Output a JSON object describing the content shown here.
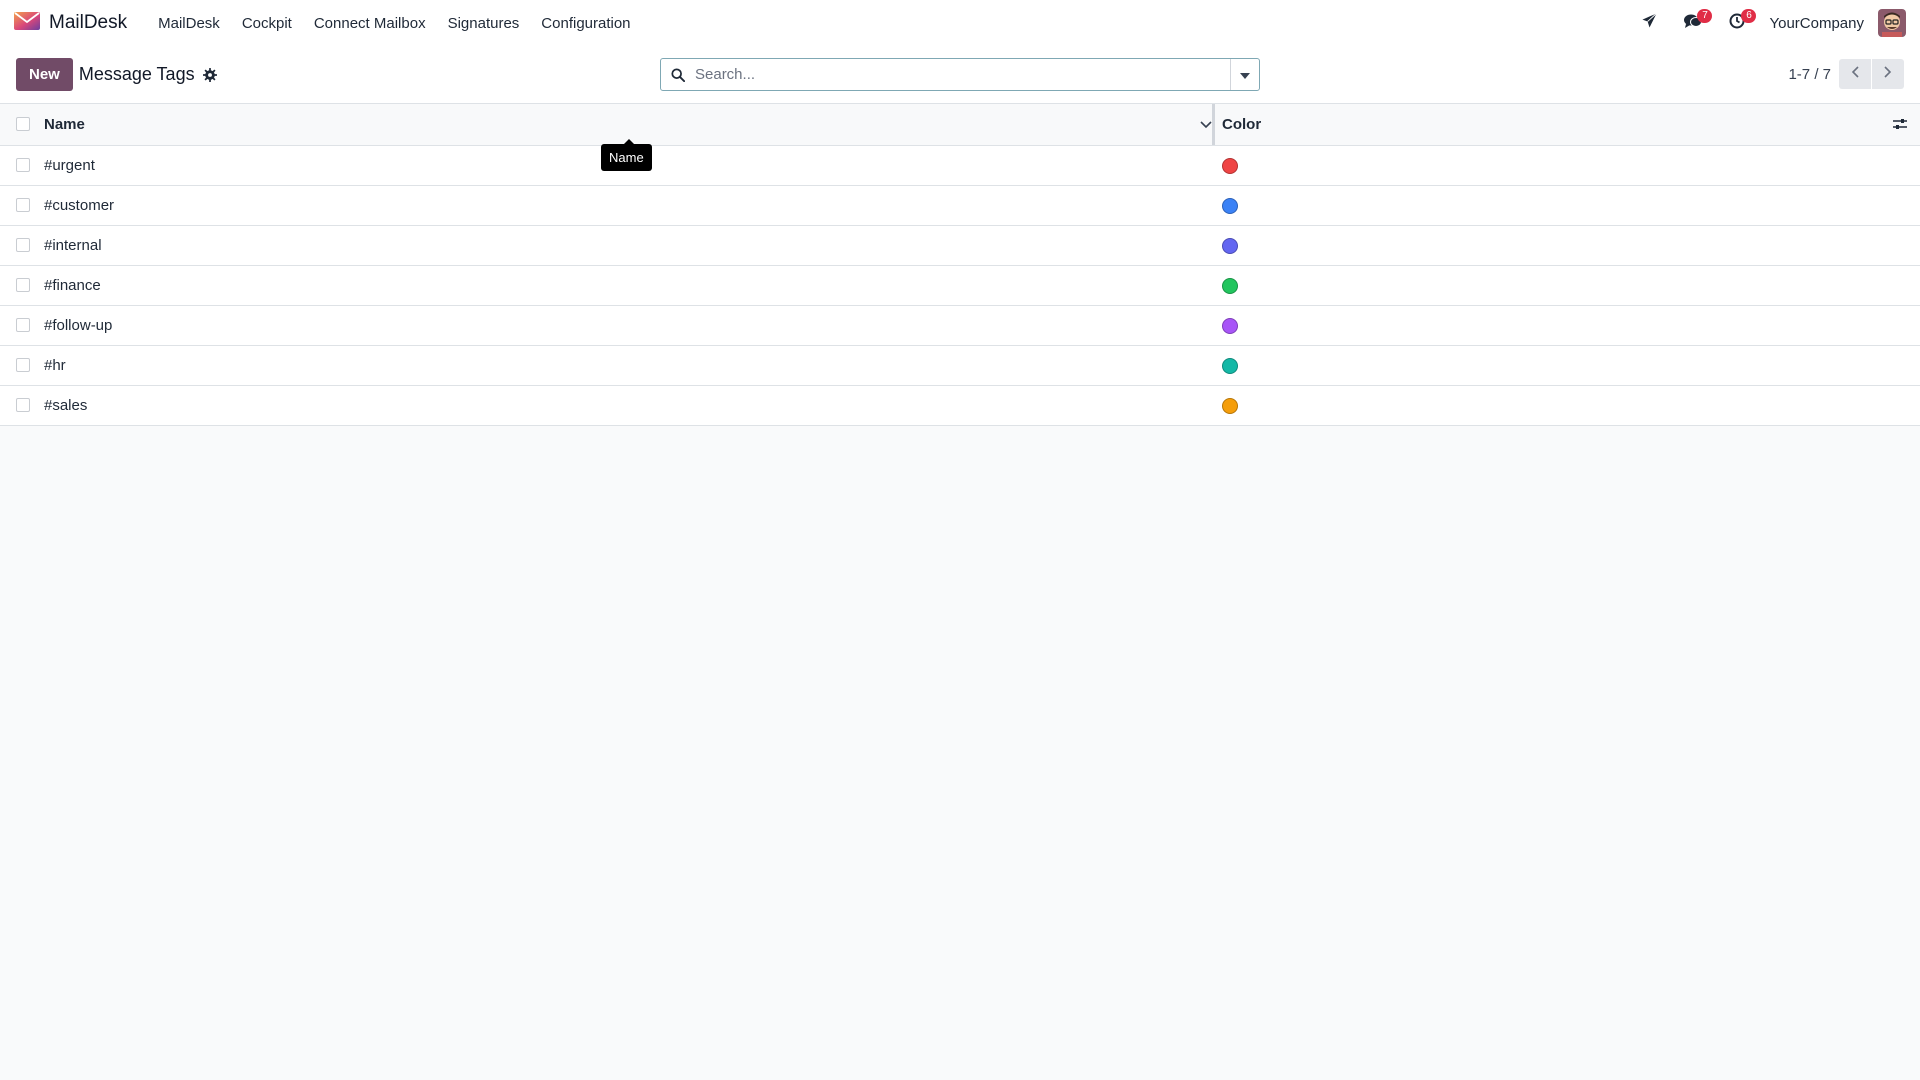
{
  "navbar": {
    "brand": "MailDesk",
    "menu": [
      "MailDesk",
      "Cockpit",
      "Connect Mailbox",
      "Signatures",
      "Configuration"
    ],
    "messages_badge": "7",
    "activities_badge": "6",
    "company": "YourCompany"
  },
  "control_panel": {
    "new_label": "New",
    "title": "Message Tags",
    "search_placeholder": "Search...",
    "pager": "1-7 / 7"
  },
  "table": {
    "columns": {
      "name": "Name",
      "color": "Color"
    },
    "rows": [
      {
        "name": "#urgent",
        "color": "#ef4444"
      },
      {
        "name": "#customer",
        "color": "#3b82f6"
      },
      {
        "name": "#internal",
        "color": "#6366f1"
      },
      {
        "name": "#finance",
        "color": "#22c55e"
      },
      {
        "name": "#follow-up",
        "color": "#a855f7"
      },
      {
        "name": "#hr",
        "color": "#14b8a6"
      },
      {
        "name": "#sales",
        "color": "#f59e0b"
      }
    ]
  },
  "tooltip": "Name",
  "icons": {
    "brand": "envelope-icon",
    "send": "paper-plane-icon",
    "messages": "chat-bubbles-icon",
    "activities": "clock-icon",
    "settings": "gear-icon",
    "search": "search-icon",
    "toggle": "caret-down-icon",
    "prev": "chevron-left-icon",
    "next": "chevron-right-icon",
    "sort": "chevron-down-icon",
    "optional_columns": "sliders-icon"
  },
  "colors": {
    "brand": "#714b67",
    "badge": "#e02d46"
  }
}
